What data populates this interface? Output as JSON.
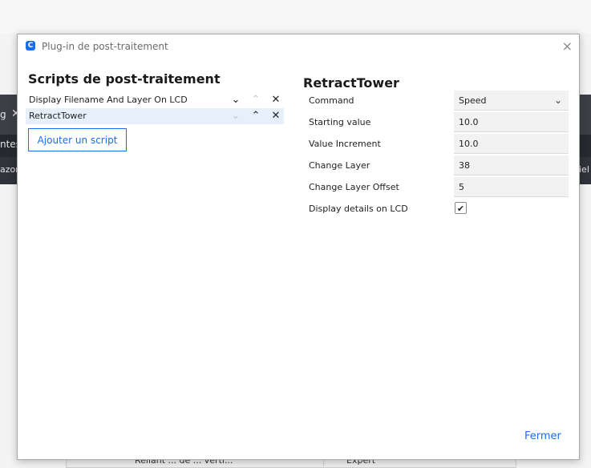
{
  "background": {
    "fragments": [
      "g",
      "ntes",
      "azon",
      "iel"
    ],
    "bottom_left_text": "Reliant ... de ... verti...",
    "bottom_right_text": "Expert"
  },
  "dialog": {
    "title": "Plug-in de post-traitement",
    "app_icon_letter": "C",
    "close_icon": "×",
    "left": {
      "heading": "Scripts de post-traitement",
      "scripts": [
        {
          "label": "Display Filename And Layer On LCD",
          "down": "⌄",
          "up": "⌃",
          "remove": "✕"
        },
        {
          "label": "RetractTower",
          "down": "⌄",
          "up": "⌃",
          "remove": "✕"
        }
      ],
      "add_button": "Ajouter un script"
    },
    "right": {
      "heading": "RetractTower",
      "settings": [
        {
          "label": "Command",
          "value": "Speed"
        },
        {
          "label": "Starting value",
          "value": "10.0"
        },
        {
          "label": "Value Increment",
          "value": "10.0"
        },
        {
          "label": "Change Layer",
          "value": "38"
        },
        {
          "label": "Change Layer Offset",
          "value": "5"
        },
        {
          "label": "Display details on LCD",
          "value": "✔"
        }
      ],
      "dropdown_chevron": "⌄"
    },
    "close_button": "Fermer"
  },
  "colors": {
    "accent": "#196ef0",
    "selected_row": "#e6f0fb"
  }
}
